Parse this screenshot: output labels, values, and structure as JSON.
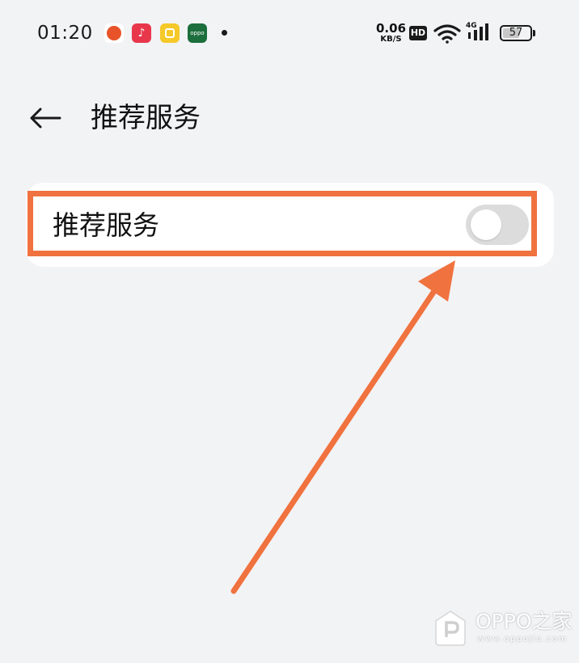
{
  "status_bar": {
    "time": "01:20",
    "music_icon_glyph": "♪",
    "oppo_badge": "oppo",
    "net_speed_value": "0.06",
    "net_speed_unit": "KB/S",
    "hd_label": "HD",
    "network_type": "4G",
    "battery_level": "57"
  },
  "header": {
    "back_icon": "back-arrow-icon",
    "title": "推荐服务"
  },
  "settings": {
    "items": [
      {
        "label": "推荐服务",
        "toggle_on": false
      }
    ]
  },
  "annotation": {
    "highlight_color": "#f0723f",
    "arrow_color": "#f0723f"
  },
  "watermark": {
    "title": "OPPO之家",
    "url": "www.oppojia.com"
  },
  "colors": {
    "background": "#f2f3f5",
    "card": "#ffffff",
    "toggle_off": "#dcdcdc"
  }
}
